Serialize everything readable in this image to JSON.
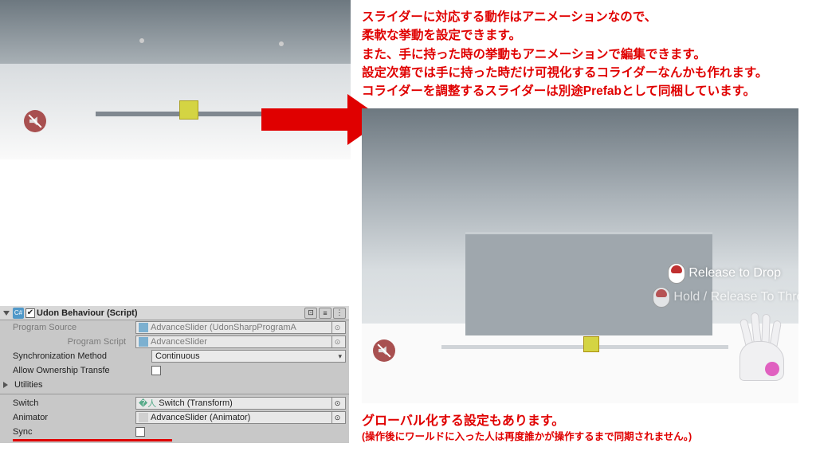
{
  "annotation_top": {
    "line1": "スライダーに対応する動作はアニメーションなので、",
    "line2": "柔軟な挙動を設定できます。",
    "line3": "また、手に持った時の挙動もアニメーションで編集できます。",
    "line4": "設定次第では手に持った時だけ可視化するコライダーなんかも作れます。",
    "line5": "コライダーを調整するスライダーは別途Prefabとして同梱しています。"
  },
  "vr_tooltip": {
    "release_drop": "Release to Drop",
    "hold_throw": "Hold / Release To Throw"
  },
  "inspector": {
    "component_title": "Udon Behaviour (Script)",
    "rows": {
      "program_source": {
        "label": "Program Source",
        "value": "AdvanceSlider (UdonSharpProgramA"
      },
      "program_script": {
        "label": "Program Script",
        "value": "AdvanceSlider"
      },
      "sync_method": {
        "label": "Synchronization Method",
        "value": "Continuous"
      },
      "allow_ownership": {
        "label": "Allow Ownership Transfe"
      },
      "utilities": {
        "label": "Utilities"
      },
      "switch": {
        "label": "Switch",
        "value": "Switch (Transform)"
      },
      "animator": {
        "label": "Animator",
        "value": "AdvanceSlider (Animator)"
      },
      "sync": {
        "label": "Sync"
      }
    }
  },
  "annotation_bottom": {
    "line1": "グローバル化する設定もあります。",
    "line2": "(操作後にワールドに入った人は再度誰かが操作するまで同期されません。)"
  }
}
